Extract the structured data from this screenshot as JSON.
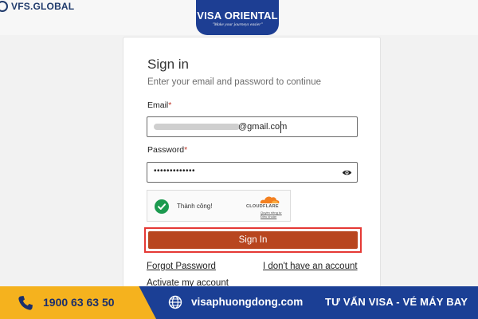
{
  "header": {
    "vfs_logo_text": "VFS.GLOBAL",
    "brand_name": "VISA ORIENTAL",
    "brand_slogan": "\"Make your journeys easier\""
  },
  "signin_form": {
    "title": "Sign in",
    "subtitle": "Enter your email and password to continue",
    "email_label": "Email",
    "required_mark": "*",
    "email_value_visible": "@gmail.com",
    "password_label": "Password",
    "password_masked": "•••••••••••••",
    "submit_label": "Sign In",
    "forgot_password": "Forgot Password",
    "no_account": "I don't have an account",
    "activate_account": "Activate my account"
  },
  "captcha": {
    "status_text": "Thành công!",
    "provider": "CLOUDFLARE",
    "privacy_link": "Quyền riêng tư",
    "terms_link": "Điều khoản",
    "success_color": "#1c9a4f",
    "provider_color": "#f38020"
  },
  "footer": {
    "phone": "1900 63 63 50",
    "website": "visaphuongdong.com",
    "tagline": "TƯ VẤN VISA - VÉ MÁY BAY",
    "phone_bg_color": "#f5b21e",
    "bar_color": "#1b3f95"
  },
  "colors": {
    "accent_button": "#b8461f",
    "highlight_border": "#e53935",
    "required": "#c0392b",
    "brand_blue": "#1d3e93"
  },
  "icons": {
    "vfs_logo": "vfs-logo-icon",
    "eye": "eye-icon",
    "check": "checkmark-icon",
    "cloud": "cloudflare-cloud-icon",
    "phone": "phone-icon",
    "globe": "globe-icon"
  }
}
